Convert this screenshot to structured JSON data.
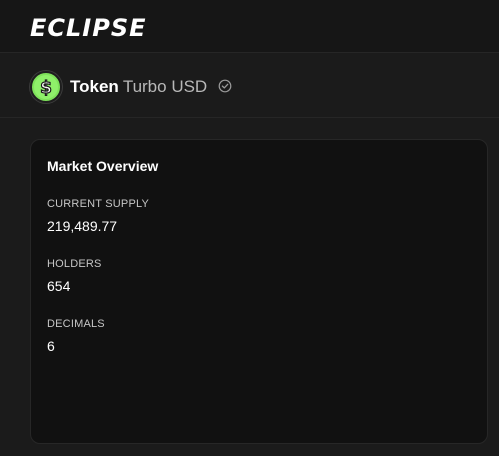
{
  "app": {
    "brand": "ECLIPSE"
  },
  "token": {
    "prefix": "Token",
    "name": "Turbo USD",
    "logo_icon": "dollar-coin-icon",
    "verified_icon": "check-circle-icon",
    "logo_color": "#7ee25a"
  },
  "market": {
    "title": "Market Overview",
    "stats": [
      {
        "label": "CURRENT SUPPLY",
        "value": "219,489.77"
      },
      {
        "label": "HOLDERS",
        "value": "654"
      },
      {
        "label": "DECIMALS",
        "value": "6"
      }
    ]
  }
}
